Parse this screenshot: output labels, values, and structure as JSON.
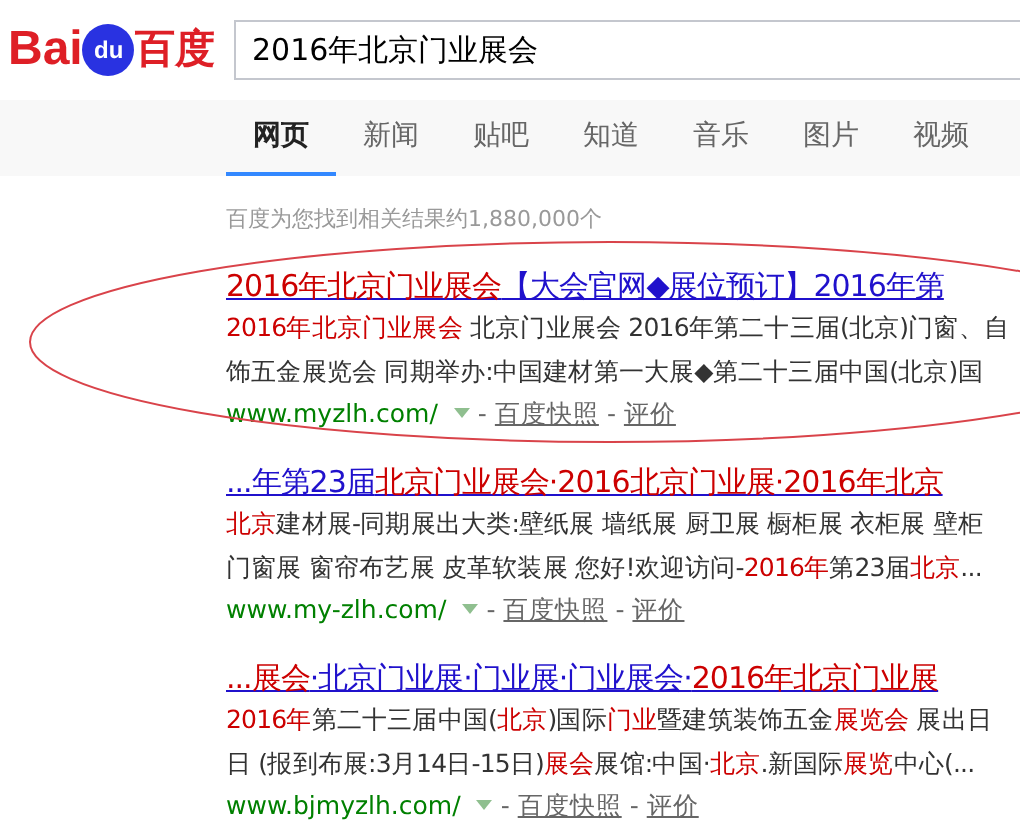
{
  "logo": {
    "left": "Bai",
    "mark": "du",
    "right": "百度"
  },
  "search": {
    "value": "2016年北京门业展会"
  },
  "tabs": [
    {
      "label": "网页",
      "selected": true
    },
    {
      "label": "新闻",
      "selected": false
    },
    {
      "label": "贴吧",
      "selected": false
    },
    {
      "label": "知道",
      "selected": false
    },
    {
      "label": "音乐",
      "selected": false
    },
    {
      "label": "图片",
      "selected": false
    },
    {
      "label": "视频",
      "selected": false
    }
  ],
  "result_count": "百度为您找到相关结果约1,880,000个",
  "results": [
    {
      "title": [
        {
          "text": "2016年北京门业展会",
          "highlight": true
        },
        {
          "text": "【大会官网◆展位预订】2016年第",
          "highlight": false
        }
      ],
      "snippet": [
        [
          {
            "text": "2016年北京门业展会",
            "highlight": true
          },
          {
            "text": " 北京门业展会 2016年第二十三届(北京)门窗、自",
            "highlight": false
          }
        ],
        [
          {
            "text": "饰五金展览会 同期举办:中国建材第一大展◆第二十三届中国(北京)国",
            "highlight": false
          }
        ]
      ],
      "url": "www.myzlh.com/",
      "separator": "-",
      "links": [
        "百度快照",
        "评价"
      ],
      "circled": true
    },
    {
      "title": [
        {
          "text": "...年第23届",
          "highlight": false
        },
        {
          "text": "北京门业展会·2016北京门业展·2016年北京",
          "highlight": true
        }
      ],
      "snippet": [
        [
          {
            "text": "北京",
            "highlight": true
          },
          {
            "text": "建材展-同期展出大类:壁纸展 墙纸展 厨卫展 橱柜展 衣柜展 壁柜",
            "highlight": false
          }
        ],
        [
          {
            "text": "门窗展 窗帘布艺展 皮革软装展 您好!欢迎访问-",
            "highlight": false
          },
          {
            "text": "2016年",
            "highlight": true
          },
          {
            "text": "第23届",
            "highlight": false
          },
          {
            "text": "北京",
            "highlight": true
          },
          {
            "text": "...",
            "highlight": false
          }
        ]
      ],
      "url": "www.my-zlh.com/",
      "separator": "-",
      "links": [
        "百度快照",
        "评价"
      ],
      "circled": false
    },
    {
      "title": [
        {
          "text": "...展会",
          "highlight": true
        },
        {
          "text": "·北京门业展·门业展·门业展会·",
          "highlight": false
        },
        {
          "text": "2016年北京门业展",
          "highlight": true
        }
      ],
      "snippet": [
        [
          {
            "text": "2016年",
            "highlight": true
          },
          {
            "text": "第二十三届中国(",
            "highlight": false
          },
          {
            "text": "北京",
            "highlight": true
          },
          {
            "text": ")国际",
            "highlight": false
          },
          {
            "text": "门业",
            "highlight": true
          },
          {
            "text": "暨建筑装饰五金",
            "highlight": false
          },
          {
            "text": "展览会",
            "highlight": true
          },
          {
            "text": " 展出日",
            "highlight": false
          }
        ],
        [
          {
            "text": "日 (报到布展:3月14日-15日)",
            "highlight": false
          },
          {
            "text": "展会",
            "highlight": true
          },
          {
            "text": "展馆:中国·",
            "highlight": false
          },
          {
            "text": "北京",
            "highlight": true
          },
          {
            "text": ".新国际",
            "highlight": false
          },
          {
            "text": "展览",
            "highlight": true
          },
          {
            "text": "中心(...",
            "highlight": false
          }
        ]
      ],
      "url": "www.bjmyzlh.com/",
      "separator": "-",
      "links": [
        "百度快照",
        "评价"
      ],
      "circled": false
    }
  ]
}
